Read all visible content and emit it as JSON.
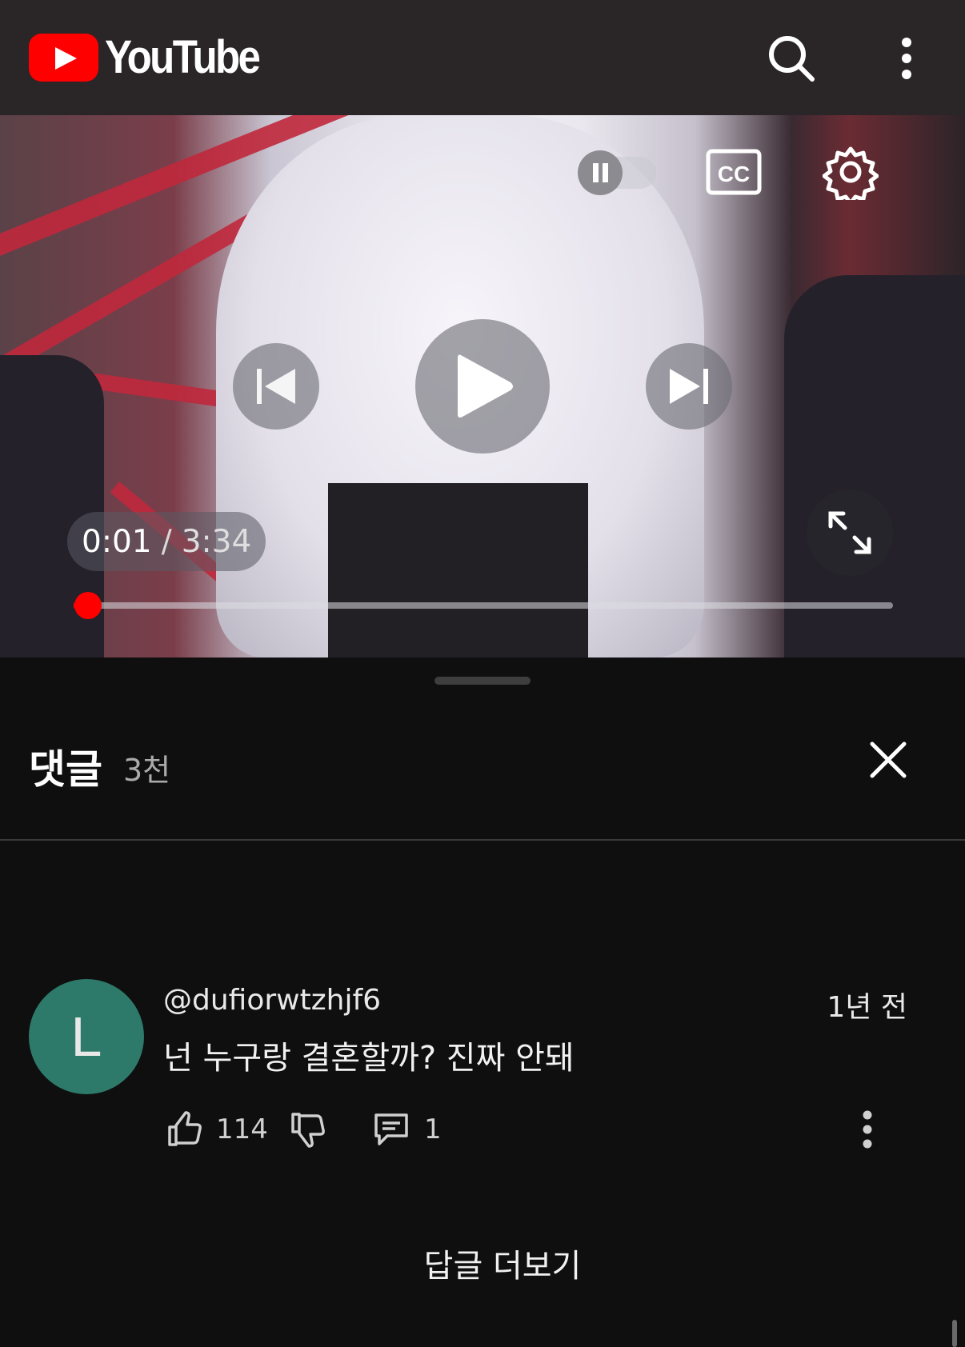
{
  "header": {
    "logo_text": "YouTube",
    "search_icon": "search-icon",
    "menu_icon": "more-vertical-icon"
  },
  "player": {
    "current_time": "0:01",
    "separator": "/",
    "duration": "3:34",
    "progress_fraction": 0.005,
    "autoplay_icon": "autoplay-toggle-icon",
    "captions_icon": "cc-icon",
    "settings_icon": "gear-icon",
    "prev_icon": "skip-previous-icon",
    "play_icon": "play-icon",
    "next_icon": "skip-next-icon",
    "fullscreen_icon": "fullscreen-icon",
    "accent_color": "#ff0000"
  },
  "comments": {
    "title": "댓글",
    "count": "3천",
    "close_icon": "close-icon",
    "items": [
      {
        "avatar_letter": "L",
        "avatar_color": "#2e7a6a",
        "author": "@dufiorwtzhjf6",
        "time": "1년 전",
        "text": "넌 누구랑 결혼할까?  진짜 안돼",
        "likes": "114",
        "replies": "1"
      }
    ],
    "more_replies_label": "답글 더보기"
  }
}
